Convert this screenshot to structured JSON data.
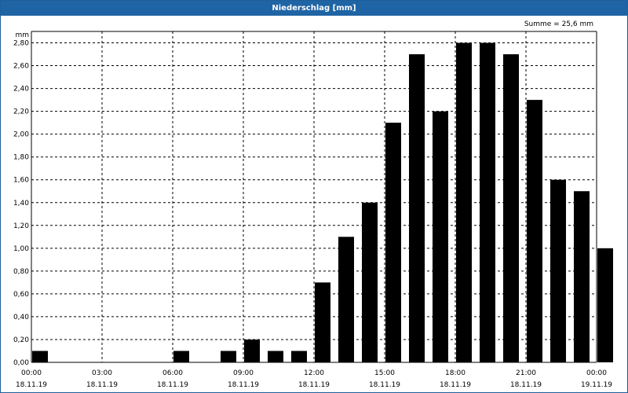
{
  "window": {
    "title": "Niederschlag [mm]"
  },
  "summary": {
    "text": "Summe = 25,6 mm"
  },
  "chart_data": {
    "type": "bar",
    "title": "Niederschlag [mm]",
    "ylabel": "mm",
    "ylim": [
      0,
      2.9
    ],
    "yticks": [
      "0,00",
      "0,20",
      "0,40",
      "0,60",
      "0,80",
      "1,00",
      "1,20",
      "1,40",
      "1,60",
      "1,80",
      "2,00",
      "2,20",
      "2,40",
      "2,60",
      "2,80"
    ],
    "xlim_hours": [
      0,
      24
    ],
    "xticks": [
      {
        "time": "00:00",
        "date": "18.11.19"
      },
      {
        "time": "03:00",
        "date": "18.11.19"
      },
      {
        "time": "06:00",
        "date": "18.11.19"
      },
      {
        "time": "09:00",
        "date": "18.11.19"
      },
      {
        "time": "12:00",
        "date": "18.11.19"
      },
      {
        "time": "15:00",
        "date": "18.11.19"
      },
      {
        "time": "18:00",
        "date": "18.11.19"
      },
      {
        "time": "21:00",
        "date": "18.11.19"
      },
      {
        "time": "00:00",
        "date": "19.11.19"
      }
    ],
    "hour_starts": [
      0,
      1,
      2,
      3,
      4,
      5,
      6,
      7,
      8,
      9,
      10,
      11,
      12,
      13,
      14,
      15,
      16,
      17,
      18,
      19,
      20,
      21,
      22,
      23
    ],
    "values": [
      0.1,
      0,
      0,
      0,
      0,
      0,
      0.1,
      0,
      0.1,
      0.2,
      0.1,
      0.1,
      0.7,
      1.1,
      1.4,
      2.1,
      2.7,
      2.2,
      2.8,
      2.8,
      2.7,
      2.3,
      1.6,
      1.5,
      1.0
    ],
    "grid": true,
    "bar_color": "#000000"
  }
}
